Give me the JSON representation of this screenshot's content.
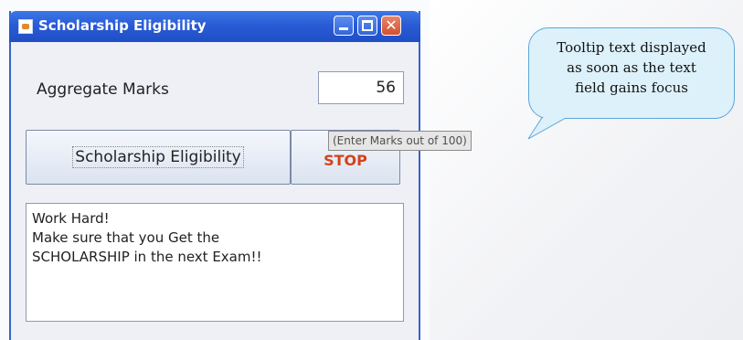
{
  "window": {
    "title": "Scholarship Eligibility",
    "close_glyph": "✕"
  },
  "form": {
    "marks_label": "Aggregate Marks",
    "marks_value": "56",
    "eligibility_button": "Scholarship Eligibility",
    "stop_button": "STOP",
    "message_lines": [
      "Work Hard!",
      "Make sure that you Get the",
      "SCHOLARSHIP in the next Exam!!"
    ]
  },
  "tooltip": {
    "text": "(Enter Marks out of 100)"
  },
  "callout": {
    "lines": [
      "Tooltip text displayed",
      "as soon as the text",
      "field gains focus"
    ]
  },
  "colors": {
    "titlebar": "#2a5bd6",
    "stop_text": "#d4421c",
    "callout_fill": "#ddf1fb",
    "callout_border": "#5aa6d6"
  }
}
